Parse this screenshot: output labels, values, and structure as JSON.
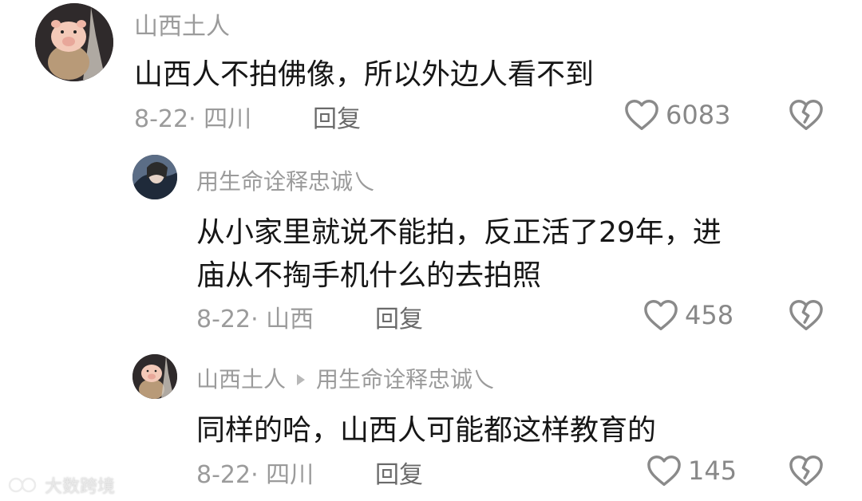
{
  "comments": [
    {
      "username": "山西土人",
      "text": "山西人不拍佛像，所以外边人看不到",
      "meta": "8-22· 四川",
      "reply": "回复",
      "likes": "6083"
    },
    {
      "username": "用生命诠释忠诚乀",
      "text_line1": "从小家里就说不能拍，反正活了29年，进",
      "text_line2": "庙从不掏手机什么的去拍照",
      "meta": "8-22· 山西",
      "reply": "回复",
      "likes": "458"
    },
    {
      "username": "山西土人",
      "reply_to": "用生命诠释忠诚乀",
      "text": "同样的哈，山西人可能都这样教育的",
      "meta": "8-22· 四川",
      "reply": "回复",
      "likes": "145"
    }
  ],
  "watermark": "大数跨境",
  "icons": {
    "like": "heart-outline-icon",
    "dislike": "broken-heart-icon",
    "arrow": "reply-arrow-icon"
  },
  "colors": {
    "muted_text": "#9b9b9b",
    "primary_text": "#161616",
    "icon": "#8a8a8a"
  }
}
